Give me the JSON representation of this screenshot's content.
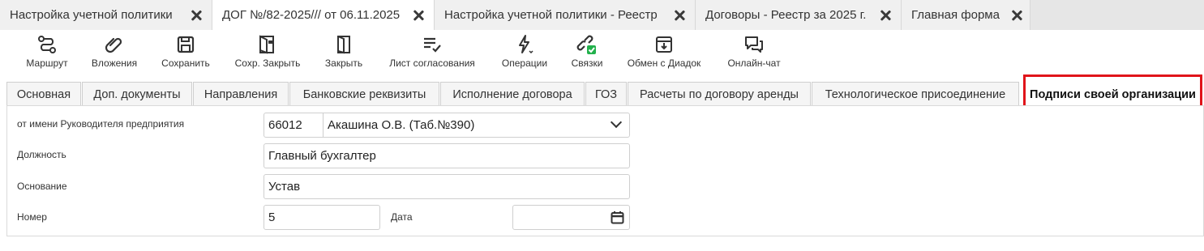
{
  "window_tabs": [
    {
      "label": "Настройка учетной политики"
    },
    {
      "label": "ДОГ №/82-2025/// от 06.11.2025"
    },
    {
      "label": "Настройка учетной политики - Реестр"
    },
    {
      "label": "Договоры - Реестр за 2025 г."
    },
    {
      "label": "Главная форма"
    }
  ],
  "toolbar": {
    "route": "Маршрут",
    "attachments": "Вложения",
    "save": "Сохранить",
    "save_close": "Сохр. Закрыть",
    "close": "Закрыть",
    "approval_sheet": "Лист согласования",
    "operations": "Операции",
    "links": "Связки",
    "diadoc": "Обмен с Диадок",
    "chat": "Онлайн-чат"
  },
  "content_tabs": [
    {
      "label": "Основная"
    },
    {
      "label": "Доп. документы"
    },
    {
      "label": "Направления"
    },
    {
      "label": "Банковские реквизиты"
    },
    {
      "label": "Исполнение договора"
    },
    {
      "label": "ГОЗ"
    },
    {
      "label": "Расчеты по договору аренды"
    },
    {
      "label": "Технологическое присоединение"
    },
    {
      "label": "Подписи своей организации"
    }
  ],
  "form": {
    "signer_label": "от имени Руководителя предприятия",
    "signer_code": "66012",
    "signer_name": "Акашина О.В. (Таб.№390)",
    "position_label": "Должность",
    "position_value": "Главный бухгалтер",
    "basis_label": "Основание",
    "basis_value": "Устав",
    "number_label": "Номер",
    "number_value": "5",
    "date_label": "Дата",
    "date_value": ""
  },
  "colors": {
    "highlight": "#e0141a",
    "links_badge": "#22b14c"
  }
}
